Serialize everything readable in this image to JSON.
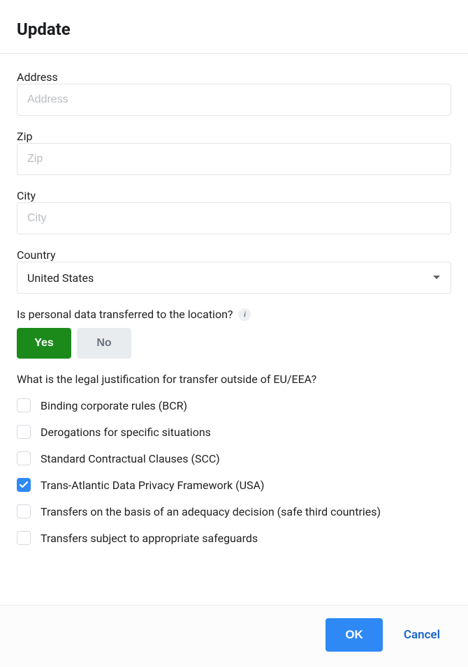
{
  "header": {
    "title": "Update"
  },
  "form": {
    "address": {
      "label": "Address",
      "placeholder": "Address",
      "value": ""
    },
    "zip": {
      "label": "Zip",
      "placeholder": "Zip",
      "value": ""
    },
    "city": {
      "label": "City",
      "placeholder": "City",
      "value": ""
    },
    "country": {
      "label": "Country",
      "selected": "United States"
    },
    "transferQuestion": {
      "label": "Is personal data transferred to the location?",
      "yes": "Yes",
      "no": "No",
      "value": "Yes"
    },
    "justification": {
      "label": "What is the legal justification for transfer outside of EU/EEA?",
      "options": [
        {
          "label": "Binding corporate rules (BCR)",
          "checked": false
        },
        {
          "label": "Derogations for specific situations",
          "checked": false
        },
        {
          "label": "Standard Contractual Clauses (SCC)",
          "checked": false
        },
        {
          "label": "Trans-Atlantic Data Privacy Framework (USA)",
          "checked": true
        },
        {
          "label": "Transfers on the basis of an adequacy decision (safe third countries)",
          "checked": false
        },
        {
          "label": "Transfers subject to appropriate safeguards",
          "checked": false
        }
      ]
    }
  },
  "footer": {
    "ok": "OK",
    "cancel": "Cancel"
  }
}
